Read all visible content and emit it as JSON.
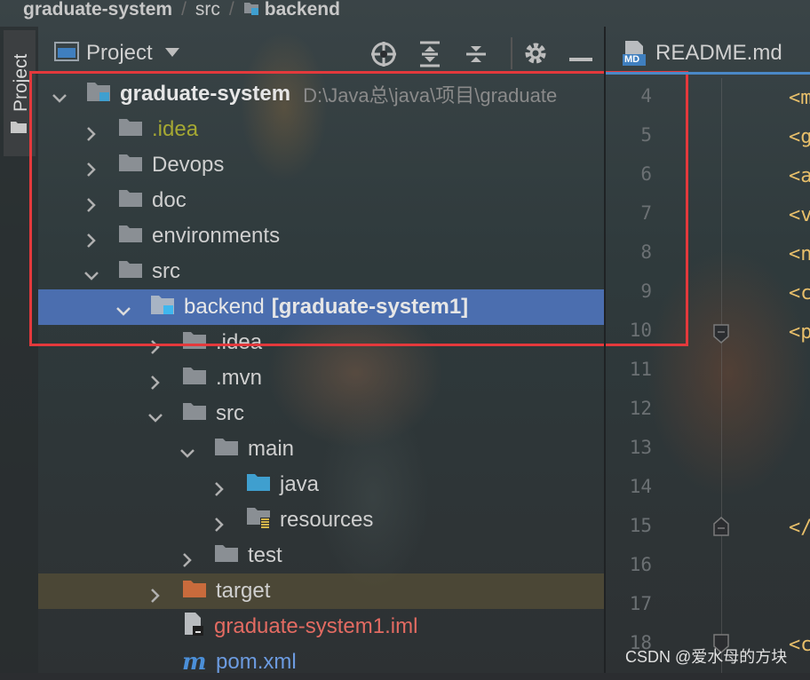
{
  "breadcrumb": {
    "root": "graduate-system",
    "src": "src",
    "module": "backend"
  },
  "tool_window": {
    "stripe_label": "Project",
    "title": "Project"
  },
  "tree": {
    "root": {
      "name": "graduate-system",
      "path": "D:\\Java总\\java\\项目\\graduate"
    },
    "items": [
      {
        "name": ".idea"
      },
      {
        "name": "Devops"
      },
      {
        "name": "doc"
      },
      {
        "name": "environments"
      },
      {
        "name": "src"
      },
      {
        "name": "backend",
        "module": "[graduate-system1]"
      },
      {
        "name": ".idea"
      },
      {
        "name": ".mvn"
      },
      {
        "name": "src"
      },
      {
        "name": "main"
      },
      {
        "name": "java"
      },
      {
        "name": "resources"
      },
      {
        "name": "test"
      },
      {
        "name": "target"
      },
      {
        "name": "graduate-system1.iml"
      },
      {
        "name": "pom.xml"
      }
    ]
  },
  "editor": {
    "tab_label": "README.md",
    "tab_icon_text": "MD",
    "line_numbers": [
      "4",
      "5",
      "6",
      "7",
      "8",
      "9",
      "10",
      "11",
      "12",
      "13",
      "14",
      "15",
      "16",
      "17",
      "18"
    ],
    "code": [
      "<m",
      "<g",
      "<a",
      "<v",
      "<n",
      "<c",
      "<p",
      "</",
      "<c"
    ]
  },
  "watermark": "CSDN @爱水母的方块",
  "colors": {
    "selection": "#4b6eaf",
    "highlight_box": "#e4393c",
    "folder": "#8a8f94",
    "source_folder": "#3f9fcf",
    "excluded_folder": "#c96b3c"
  }
}
